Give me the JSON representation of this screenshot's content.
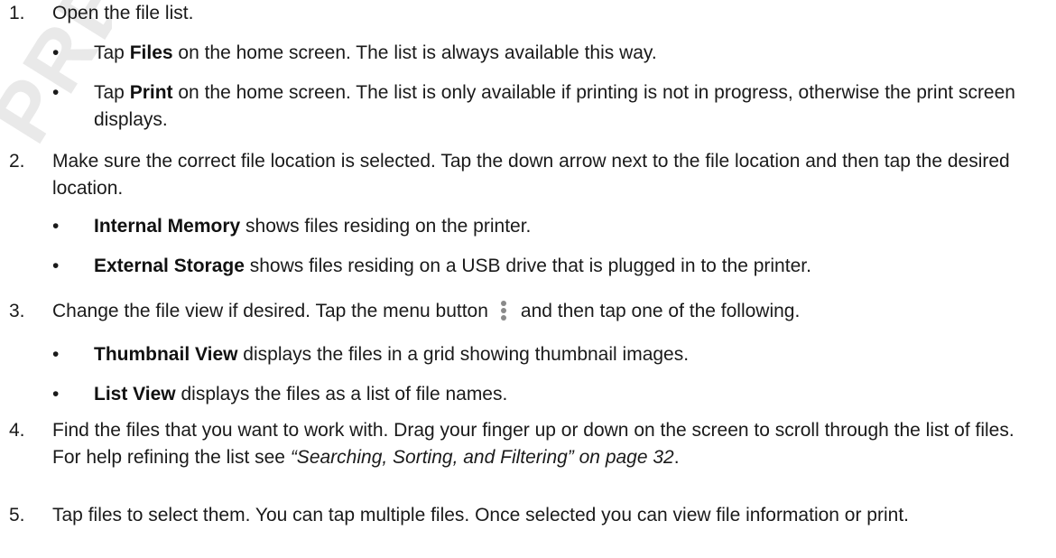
{
  "watermark": "PRELIMINARY",
  "steps": [
    {
      "num": "1.",
      "text": "Open the file list.",
      "bullets": [
        {
          "bold": "Files",
          "pre": "Tap ",
          "rest": " on the home screen. The list is always available this way."
        },
        {
          "bold": "Print",
          "pre": "Tap ",
          "rest": " on the home screen. The list is only available if printing is not in progress, otherwise the print screen displays."
        }
      ]
    },
    {
      "num": "2.",
      "text": "Make sure the correct file location is selected. Tap the down arrow next to the file location and then tap the desired location.",
      "bullets": [
        {
          "bold": "Internal Memory",
          "rest": " shows files residing on the printer."
        },
        {
          "bold": "External Storage",
          "rest": " shows files residing on a USB drive that is plugged in to the printer."
        }
      ]
    },
    {
      "num": "3.",
      "text_before_icon": "Change the file view if desired. Tap the menu button",
      "text_after_icon": "and then tap one of the following.",
      "icon": "vertical-dots-menu-icon",
      "bullets": [
        {
          "bold": "Thumbnail View",
          "rest": " displays the files in a grid showing thumbnail images."
        },
        {
          "bold": "List View",
          "rest": " displays the files as a list of file names."
        }
      ]
    },
    {
      "num": "4.",
      "text": "Find the files that you want to work with. Drag your finger up or down on the screen to scroll through the list of files. For help refining the list see ",
      "link": "“Searching, Sorting, and Filtering” on page 32",
      "text_end": "."
    },
    {
      "num": "5.",
      "text": "Tap files to select them. You can tap multiple files. Once selected you can view file information or print."
    }
  ],
  "bullet_char": "•"
}
